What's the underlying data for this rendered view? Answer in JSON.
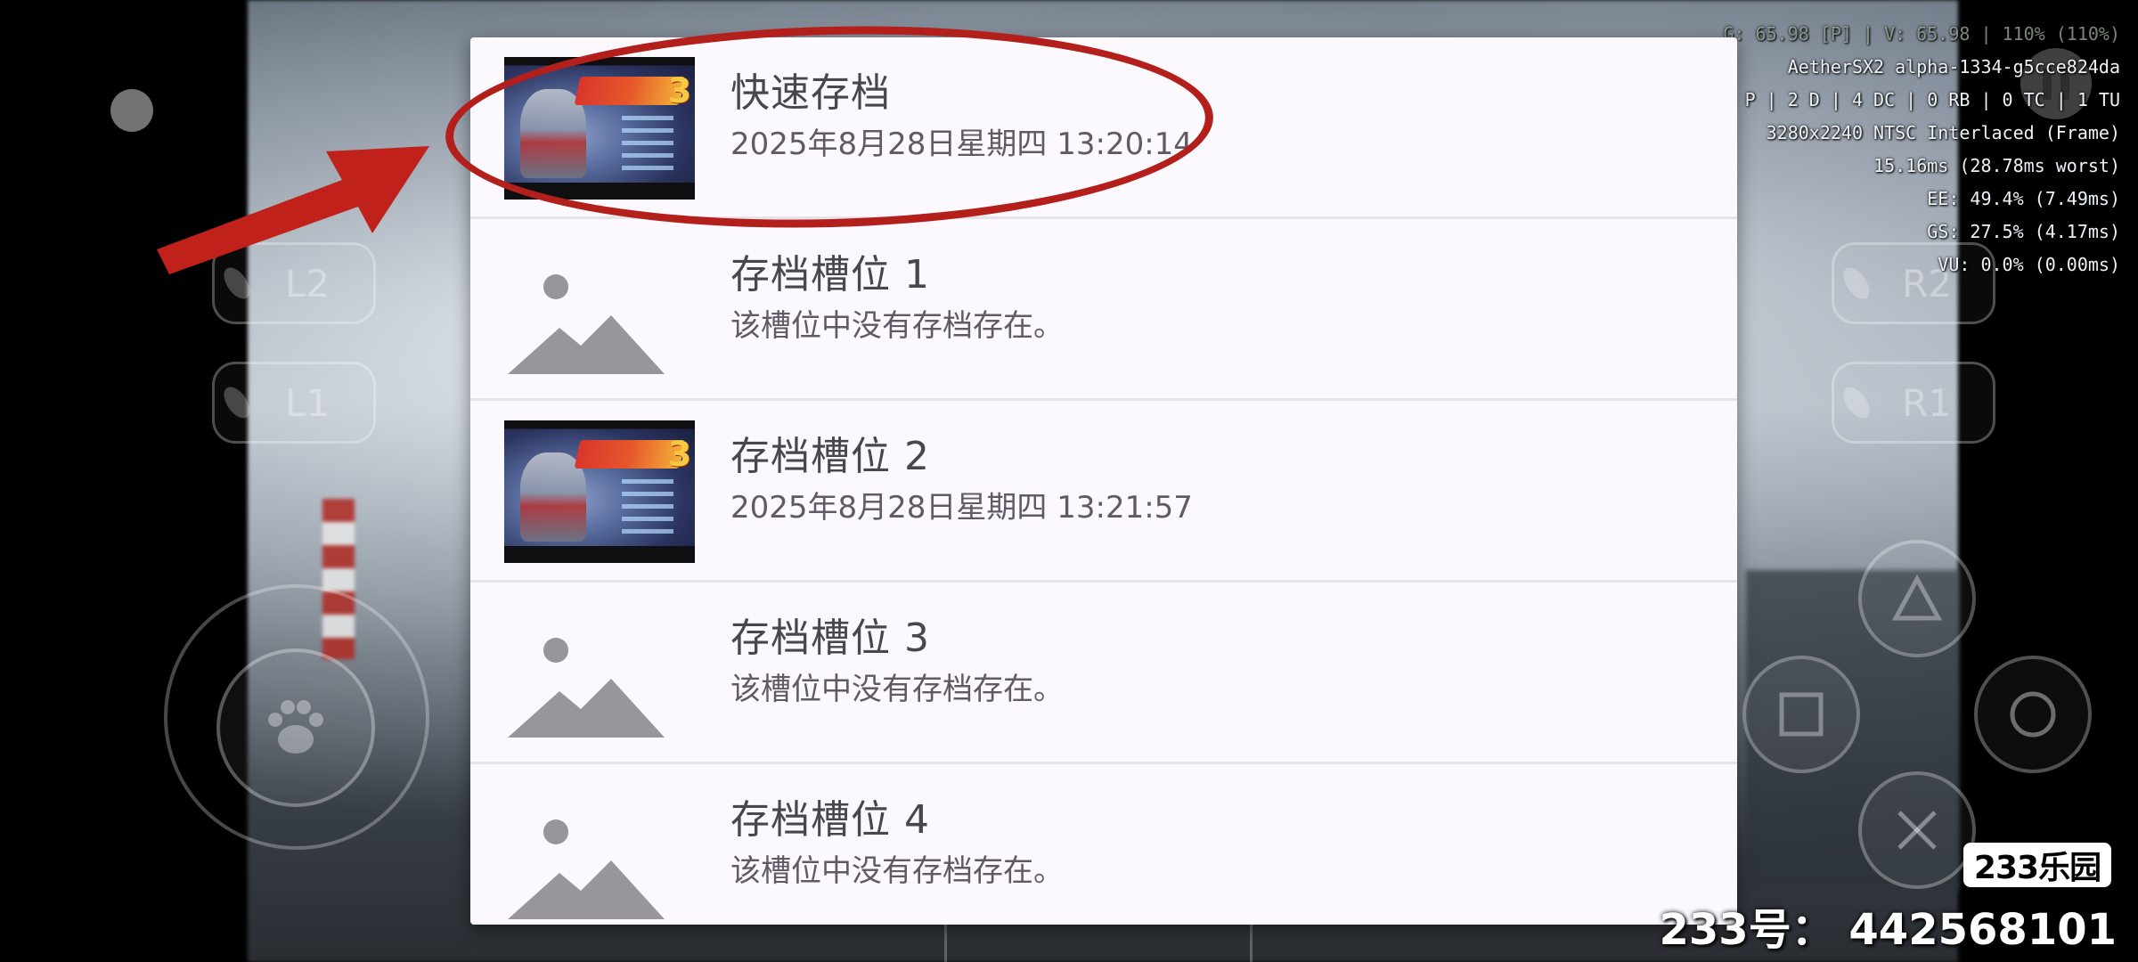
{
  "overlay": {
    "lines": [
      "G: 65.98 [P] | V: 65.98 | 110% (110%)",
      "AetherSX2 alpha-1334-g5cce824da",
      "P | 2 D | 4 DC | 0 RB | 0 TC | 1 TU",
      "3280x2240 NTSC Interlaced (Frame)",
      "15.16ms (28.78ms worst)",
      "EE: 49.4% (7.49ms)",
      "GS: 27.5% (4.17ms)",
      "VU: 0.0% (0.00ms)"
    ]
  },
  "controls": {
    "l2": "L2",
    "l1": "L1",
    "r2": "R2",
    "r1": "R1"
  },
  "dialog": {
    "slots": [
      {
        "title": "快速存档",
        "subtitle": "2025年8月28日星期四 13:20:14",
        "has_thumbnail": true
      },
      {
        "title": "存档槽位 1",
        "subtitle": "该槽位中没有存档存在。",
        "has_thumbnail": false
      },
      {
        "title": "存档槽位 2",
        "subtitle": "2025年8月28日星期四 13:21:57",
        "has_thumbnail": true
      },
      {
        "title": "存档槽位 3",
        "subtitle": "该槽位中没有存档存在。",
        "has_thumbnail": false
      },
      {
        "title": "存档槽位 4",
        "subtitle": "该槽位中没有存档存在。",
        "has_thumbnail": false
      }
    ]
  },
  "annotation": {
    "color": "#b3201b"
  },
  "watermark": {
    "logo": "233乐园",
    "text": "233号： 442568101"
  }
}
